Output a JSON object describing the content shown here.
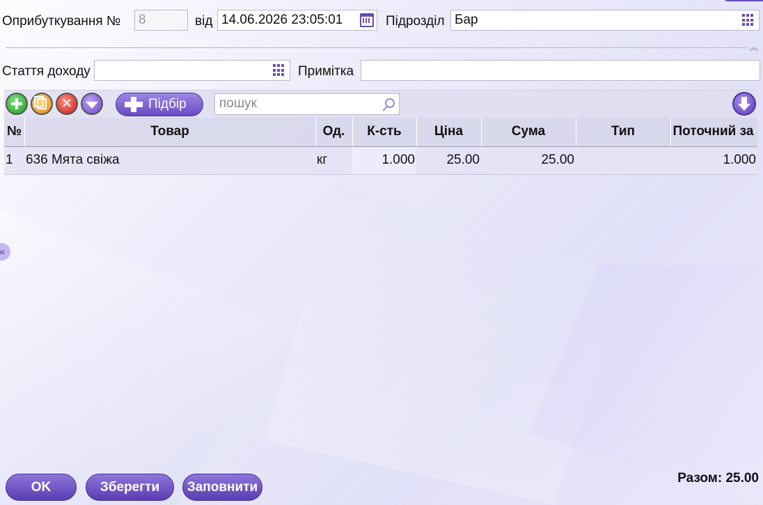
{
  "header": {
    "receipt_label": "Оприбуткування №",
    "receipt_number": "8",
    "from_label": "від",
    "date_value": "14.06.2026 23:05:01",
    "division_label": "Підрозділ",
    "division_value": "Бар",
    "income_article_label": "Стаття доходу",
    "income_article_value": "",
    "note_label": "Примітка",
    "note_value": ""
  },
  "toolbar": {
    "pick_label": "Підбір",
    "search_placeholder": "пошук",
    "add_icon": "plus-circle-icon",
    "copy_icon": "copy-icon",
    "delete_icon": "delete-icon",
    "filter_icon": "filter-icon",
    "export_icon": "arrow-down-icon"
  },
  "table": {
    "columns": [
      "№",
      "Товар",
      "Од.",
      "К-сть",
      "Ціна",
      "Сума",
      "Тип",
      "Поточний за"
    ],
    "rows": [
      {
        "num": "1",
        "product": "636 Мята свіжа",
        "unit": "кг",
        "qty": "1.000",
        "price": "25.00",
        "sum": "25.00",
        "type": "",
        "current": "1.000"
      }
    ]
  },
  "footer": {
    "ok_label": "OK",
    "save_label": "Зберегти",
    "fill_label": "Заповнити",
    "total_label": "Разом: 25.00"
  },
  "sidebar_toggle": "«",
  "collapse_toggle": "︽",
  "colors": {
    "accent": "#6a4bc2",
    "header_bg": "#d6d6ea",
    "row_bg": "#e4e4f6"
  }
}
